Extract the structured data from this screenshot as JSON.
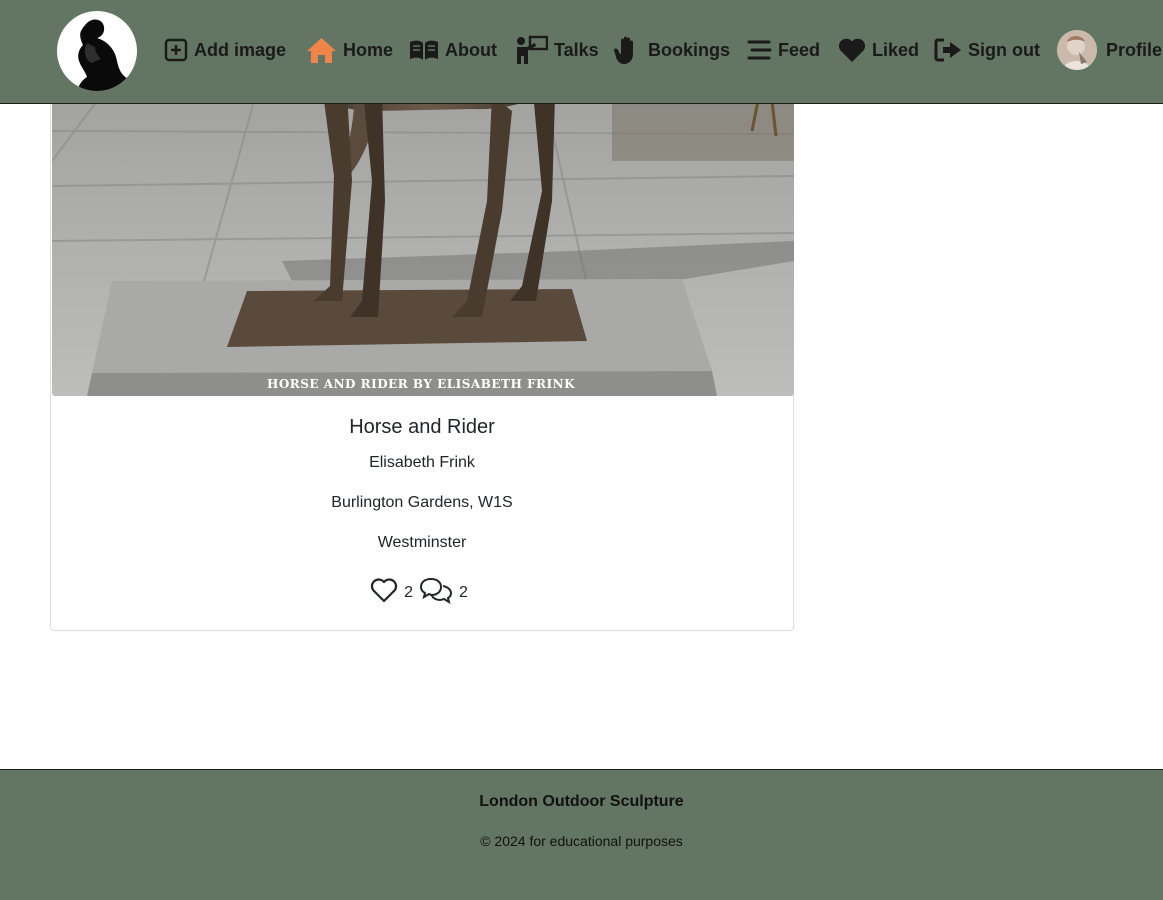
{
  "navbar": {
    "logo_icon": "thinker-silhouette-icon",
    "items": [
      {
        "label": "Add image",
        "icon": "plus-square-icon"
      },
      {
        "label": "Home",
        "icon": "home-icon",
        "color": "#f0854a"
      },
      {
        "label": "About",
        "icon": "book-open-icon"
      },
      {
        "label": "Talks",
        "icon": "presenter-icon"
      },
      {
        "label": "Bookings",
        "icon": "hand-icon"
      },
      {
        "label": "Feed",
        "icon": "stream-icon"
      },
      {
        "label": "Liked",
        "icon": "heart-icon"
      },
      {
        "label": "Sign out",
        "icon": "sign-out-icon"
      },
      {
        "label": "Profile",
        "icon": "avatar"
      }
    ]
  },
  "post": {
    "image_caption": "HORSE AND RIDER BY ELISABETH FRINK",
    "title": "Horse and Rider",
    "artist": "Elisabeth Frink",
    "location": "Burlington Gardens, W1S",
    "borough": "Westminster",
    "likes_count": "2",
    "comments_count": "2"
  },
  "footer": {
    "title": "London Outdoor Sculpture",
    "copyright": "© 2024 for educational purposes"
  },
  "colors": {
    "nav_bg": "#637563",
    "home_accent": "#f0854a",
    "text_dark": "#1a1a1a"
  }
}
